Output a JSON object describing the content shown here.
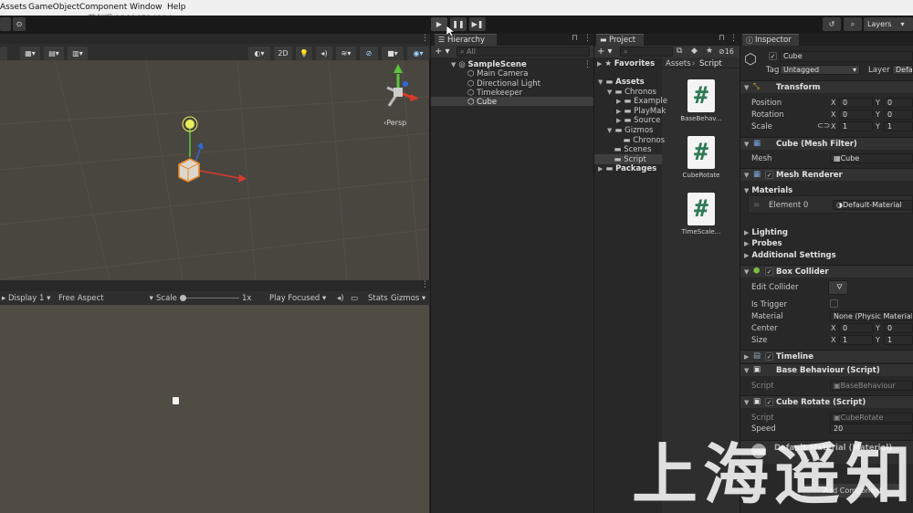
{
  "menu": [
    "Assets",
    "GameObject",
    "Component",
    "Window",
    "Help"
  ],
  "watermark_phone": "苑剑辉 13696524994",
  "toolbar": {
    "play": "▶",
    "pause": "❚❚",
    "step": "▶❚",
    "layers": "Layers",
    "view_2d": "2D"
  },
  "scene": {
    "persp_label": "‹Persp"
  },
  "game": {
    "display": "Display 1",
    "aspect": "Free Aspect",
    "scale_label": "Scale",
    "scale_value": "1x",
    "play_focused": "Play Focused",
    "stats": "Stats",
    "gizmos": "Gizmos"
  },
  "hierarchy": {
    "tab": "Hierarchy",
    "search_placeholder": "All",
    "scene": "SampleScene",
    "items": [
      "Main Camera",
      "Directional Light",
      "Timekeeper",
      "Cube"
    ]
  },
  "project": {
    "tab": "Project",
    "favorites": "Favorites",
    "breadcrumb_root": "Assets",
    "breadcrumb_child": "Script",
    "count": "16",
    "tree": [
      {
        "label": "Assets",
        "level": 0,
        "expanded": true
      },
      {
        "label": "Chronos",
        "level": 1,
        "expanded": true
      },
      {
        "label": "Example",
        "level": 2,
        "expanded": false
      },
      {
        "label": "PlayMak",
        "level": 2,
        "expanded": false
      },
      {
        "label": "Source",
        "level": 2,
        "expanded": false
      },
      {
        "label": "Gizmos",
        "level": 1,
        "expanded": true
      },
      {
        "label": "Chronos",
        "level": 2,
        "expanded": null
      },
      {
        "label": "Scenes",
        "level": 1,
        "expanded": null
      },
      {
        "label": "Script",
        "level": 1,
        "expanded": null
      },
      {
        "label": "Packages",
        "level": 0,
        "expanded": false
      }
    ],
    "files": [
      "BaseBehav...",
      "CubeRotate",
      "TimeScale..."
    ],
    "file_glyph": "#"
  },
  "inspector": {
    "tab": "Inspector",
    "object_name": "Cube",
    "tag_label": "Tag",
    "tag_value": "Untagged",
    "layer_label": "Layer",
    "layer_value": "Defau",
    "transform": {
      "title": "Transform",
      "position_label": "Position",
      "rotation_label": "Rotation",
      "scale_label": "Scale",
      "position": [
        "0",
        "0"
      ],
      "rotation": [
        "0",
        "0"
      ],
      "scale": [
        "1",
        "1"
      ]
    },
    "axis_x": "X",
    "axis_y": "Y",
    "mesh_filter": {
      "title": "Cube (Mesh Filter)",
      "mesh_label": "Mesh",
      "mesh_value": "Cube"
    },
    "mesh_renderer": {
      "title": "Mesh Renderer",
      "materials_label": "Materials",
      "element_label": "Element 0",
      "element_value": "Default-Material",
      "lighting": "Lighting",
      "probes": "Probes",
      "additional": "Additional Settings"
    },
    "box_collider": {
      "title": "Box Collider",
      "edit_label": "Edit Collider",
      "trigger_label": "Is Trigger",
      "material_label": "Material",
      "material_value": "None (Physic Material)",
      "center_label": "Center",
      "size_label": "Size",
      "center": [
        "0",
        "0"
      ],
      "size": [
        "1",
        "1"
      ]
    },
    "timeline": {
      "title": "Timeline"
    },
    "base_behaviour": {
      "title": "Base Behaviour (Script)",
      "script_label": "Script",
      "script_value": "BaseBehaviour"
    },
    "cube_rotate": {
      "title": "Cube Rotate (Script)",
      "script_label": "Script",
      "script_value": "CubeRotate",
      "speed_label": "Speed",
      "speed_value": "20"
    },
    "default_material": "Default-Material (Material)",
    "add_component": "Add Component"
  },
  "overlay_watermark": "上海遥知",
  "colors": {
    "scene_bg": "#49453f",
    "game_bg": "#504b43",
    "panel": "#282828",
    "selection": "#2c5d87",
    "accent_red": "#d63b2b",
    "accent_green": "#5cc43a",
    "accent_blue": "#2f6ad8"
  }
}
